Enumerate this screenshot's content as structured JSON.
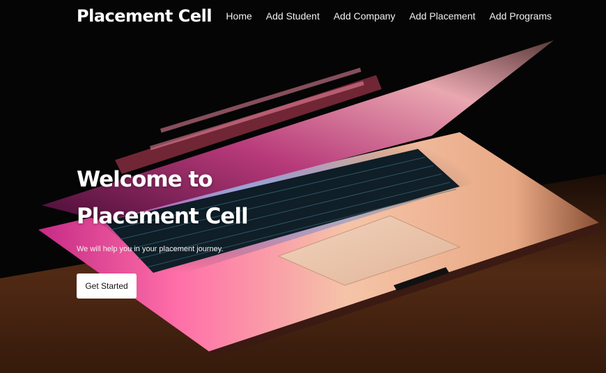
{
  "navbar": {
    "brand": "Placement Cell",
    "links": [
      {
        "label": "Home"
      },
      {
        "label": "Add Student"
      },
      {
        "label": "Add Company"
      },
      {
        "label": "Add Placement"
      },
      {
        "label": "Add Programs"
      }
    ]
  },
  "hero": {
    "title": "Welcome to Placement Cell",
    "subtitle": "We will help you in your placement journey.",
    "cta_label": "Get Started"
  },
  "colors": {
    "background": "#050505",
    "text": "#ffffff",
    "button_bg": "#ffffff",
    "button_text": "#111111"
  }
}
